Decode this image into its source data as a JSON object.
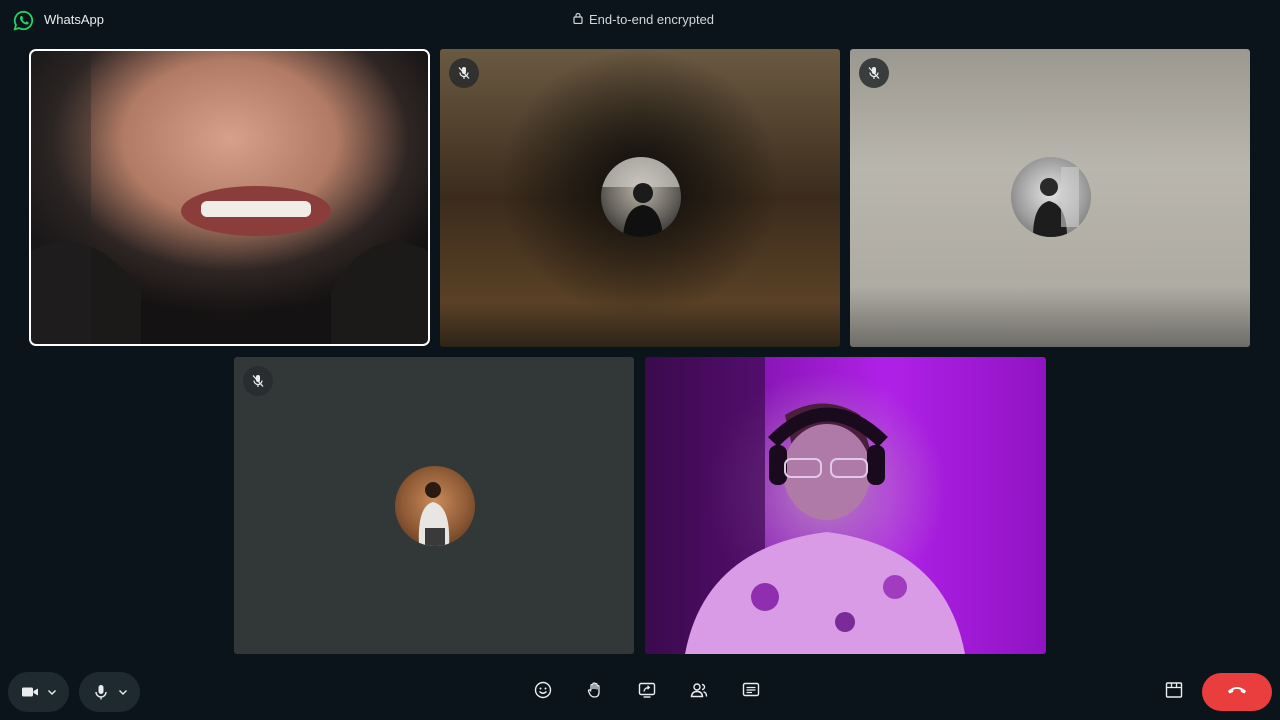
{
  "app": {
    "name": "WhatsApp",
    "encryption_label": "End-to-end encrypted"
  },
  "participants": [
    {
      "tile": 1,
      "video_on": true,
      "muted": false,
      "active_speaker": true
    },
    {
      "tile": 2,
      "video_on": false,
      "muted": true,
      "active_speaker": false
    },
    {
      "tile": 3,
      "video_on": false,
      "muted": true,
      "active_speaker": false
    },
    {
      "tile": 4,
      "video_on": false,
      "muted": true,
      "active_speaker": false
    },
    {
      "tile": 5,
      "video_on": true,
      "muted": false,
      "active_speaker": false
    }
  ],
  "controls": {
    "left": [
      "camera-icon",
      "microphone-icon"
    ],
    "center": [
      "emoji-reaction-icon",
      "raise-hand-icon",
      "screen-share-icon",
      "participants-icon",
      "chat-icon"
    ],
    "right": [
      "layout-icon",
      "end-call-icon"
    ]
  },
  "colors": {
    "background": "#0b141a",
    "end_call": "#ea3d3d",
    "brand": "#25d366",
    "active_outline": "#ffffff"
  }
}
